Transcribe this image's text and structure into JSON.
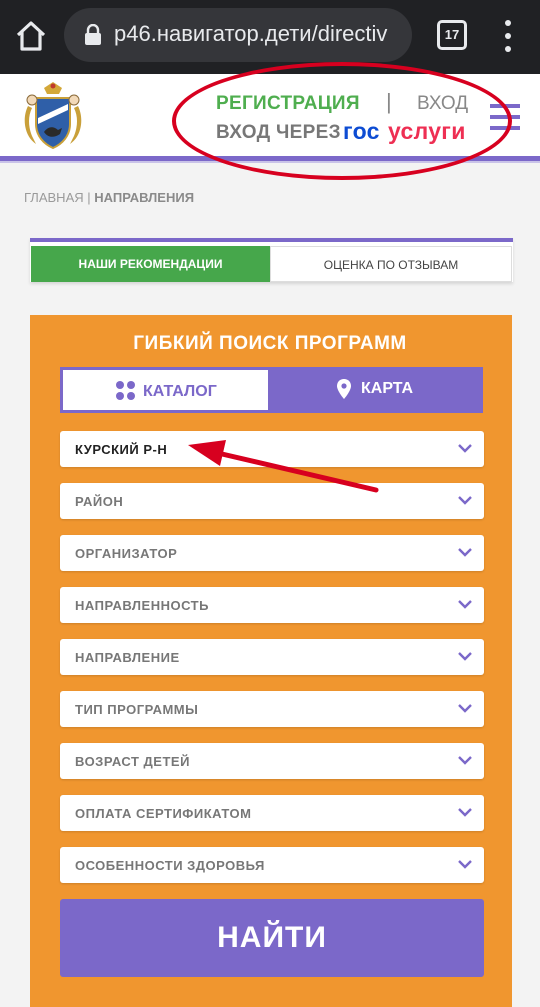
{
  "browser": {
    "url": "p46.навигатор.дети/directiv",
    "tab_count": "17"
  },
  "header": {
    "register_label": "РЕГИСТРАЦИЯ",
    "separator": "|",
    "login_label": "ВХОД",
    "gosuslugi_prefix": "ВХОД ЧЕРЕЗ",
    "gosuslugi_part1": "гос",
    "gosuslugi_part2": "услуги"
  },
  "breadcrumb": {
    "home": "ГЛАВНАЯ",
    "sep": " | ",
    "current": "НАПРАВЛЕНИЯ"
  },
  "tabs": {
    "recommendations": "НАШИ РЕКОМЕНДАЦИИ",
    "reviews": "ОЦЕНКА ПО ОТЗЫВАМ"
  },
  "search": {
    "title": "ГИБКИЙ ПОИСК ПРОГРАММ",
    "catalog_label": "КАТАЛОГ",
    "map_label": "КАРТА",
    "filters": [
      "КУРСКИЙ Р-Н",
      "РАЙОН",
      "ОРГАНИЗАТОР",
      "НАПРАВЛЕННОСТЬ",
      "НАПРАВЛЕНИЕ",
      "ТИП ПРОГРАММЫ",
      "ВОЗРАСТ ДЕТЕЙ",
      "ОПЛАТА СЕРТИФИКАТОМ",
      "ОСОБЕННОСТИ ЗДОРОВЬЯ"
    ],
    "find_label": "НАЙТИ"
  },
  "colors": {
    "accent": "#7b68c9",
    "green": "#46a74b",
    "orange": "#f0962f",
    "annotation": "#d7001f"
  }
}
